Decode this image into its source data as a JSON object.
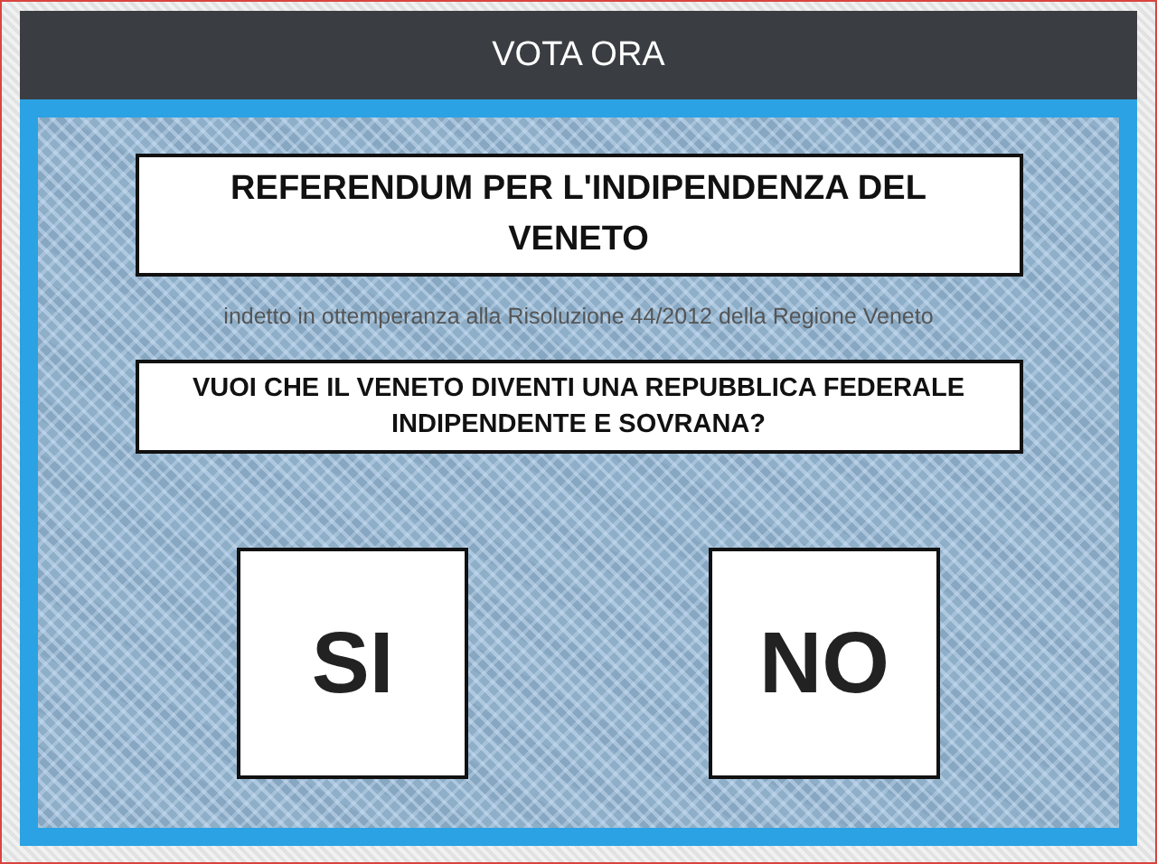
{
  "header": {
    "title": "VOTA ORA"
  },
  "referendum": {
    "title": "REFERENDUM PER L'INDIPENDENZA DEL VENETO",
    "subtitle": "indetto in ottemperanza alla Risoluzione 44/2012 della Regione Veneto",
    "question": "VUOI CHE IL VENETO DIVENTI UNA REPUBBLICA FEDERALE INDIPENDENTE E SOVRANA?"
  },
  "answers": [
    {
      "label": "SI"
    },
    {
      "label": "NO"
    }
  ]
}
